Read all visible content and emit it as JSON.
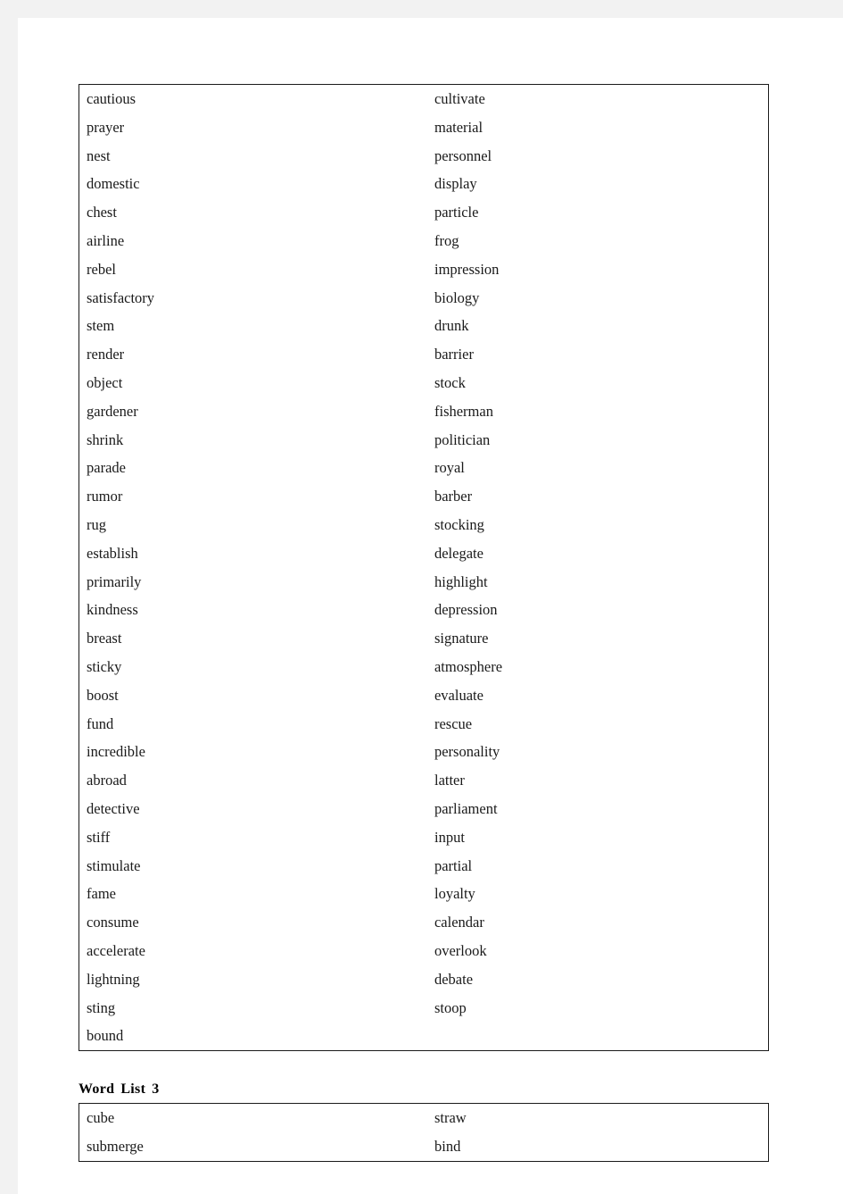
{
  "document": {
    "page_background": "#f2f2f2",
    "paper_background": "#ffffff",
    "text_color": "#1a1a1a",
    "border_color": "#1a1a1a",
    "dotted_divider_color_left": "#808080",
    "dotted_divider_color_right": "#0d0d0d"
  },
  "word_list_table": {
    "columns": [
      {
        "name": "words-column-1",
        "words": [
          "cautious",
          "prayer",
          "nest",
          "domestic",
          "chest",
          "airline",
          "rebel",
          "satisfactory",
          "stem",
          "render",
          "object",
          "gardener",
          "shrink",
          "parade",
          "rumor",
          "rug",
          "establish",
          "primarily",
          "kindness",
          "breast",
          "sticky",
          "boost",
          "fund",
          "incredible",
          "abroad",
          "detective",
          "stiff",
          "stimulate",
          "fame",
          "consume",
          "accelerate",
          "lightning",
          "sting",
          "bound"
        ]
      },
      {
        "name": "answers-column-1",
        "words": []
      },
      {
        "name": "words-column-2",
        "words": [
          "cultivate",
          "material",
          "personnel",
          "display",
          "particle",
          "frog",
          "impression",
          "biology",
          "drunk",
          "barrier",
          "stock",
          "fisherman",
          "politician",
          "royal",
          "barber",
          "stocking",
          "delegate",
          "highlight",
          "depression",
          "signature",
          "atmosphere",
          "evaluate",
          "rescue",
          "personality",
          "latter",
          "parliament",
          "input",
          "partial",
          "loyalty",
          "calendar",
          "overlook",
          "debate",
          "stoop"
        ]
      },
      {
        "name": "answers-column-2",
        "words": []
      }
    ]
  },
  "word_list_3": {
    "heading_words": [
      "Word",
      "List",
      "3"
    ],
    "heading_text": "Word List 3",
    "columns": [
      {
        "name": "words-column-1",
        "words": [
          "cube",
          "submerge"
        ]
      },
      {
        "name": "answers-column-1",
        "words": []
      },
      {
        "name": "words-column-2",
        "words": [
          "straw",
          "bind"
        ]
      },
      {
        "name": "answers-column-2",
        "words": []
      }
    ]
  }
}
